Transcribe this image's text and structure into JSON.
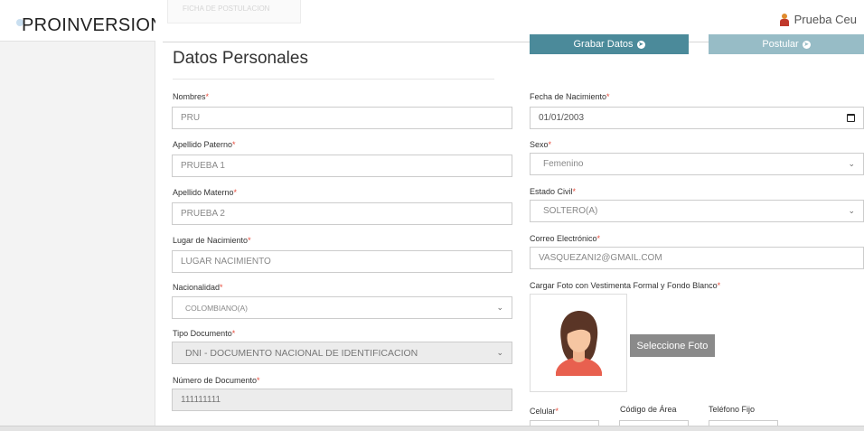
{
  "app": {
    "brand": "PROINVERSION",
    "ghost_tab": "FICHA DE POSTULACION"
  },
  "user": {
    "name": "Prueba Ceu"
  },
  "section": {
    "title": "Datos Personales"
  },
  "actions": {
    "save_label": "Grabar Datos",
    "postulate_label": "Postular",
    "upload_photo_label": "Seleccione Foto"
  },
  "form": {
    "nombres": {
      "label": "Nombres",
      "value": "PRU"
    },
    "apellido_paterno": {
      "label": "Apellido Paterno",
      "value": "PRUEBA 1"
    },
    "apellido_materno": {
      "label": "Apellido Materno",
      "value": "PRUEBA 2"
    },
    "lugar_nacimiento": {
      "label": "Lugar de Nacimiento",
      "value": "LUGAR NACIMIENTO"
    },
    "nacionalidad": {
      "label": "Nacionalidad",
      "value": "COLOMBIANO(A)"
    },
    "tipo_documento": {
      "label": "Tipo Documento",
      "value": "DNI - DOCUMENTO NACIONAL DE IDENTIFICACION"
    },
    "numero_documento": {
      "label": "Número de Documento",
      "value": "111111111"
    },
    "fecha_nacimiento": {
      "label": "Fecha de Nacimiento",
      "value": "01/01/2003"
    },
    "sexo": {
      "label": "Sexo",
      "value": "Femenino"
    },
    "estado_civil": {
      "label": "Estado Civil",
      "value": "SOLTERO(A)"
    },
    "correo": {
      "label": "Correo Electrónico",
      "value": "VASQUEZANI2@GMAIL.COM"
    },
    "foto": {
      "label": "Cargar Foto con Vestimenta Formal y Fondo Blanco"
    },
    "celular": {
      "label": "Celular"
    },
    "codigo_area": {
      "label": "Código de Área"
    },
    "telefono_fijo": {
      "label": "Teléfono Fijo"
    },
    "required_mark": "*"
  },
  "colors": {
    "primary": "#4b8a9a",
    "primary_disabled": "#97bcc6",
    "required": "#e74c3c",
    "photo_button": "#8a8a8a"
  }
}
